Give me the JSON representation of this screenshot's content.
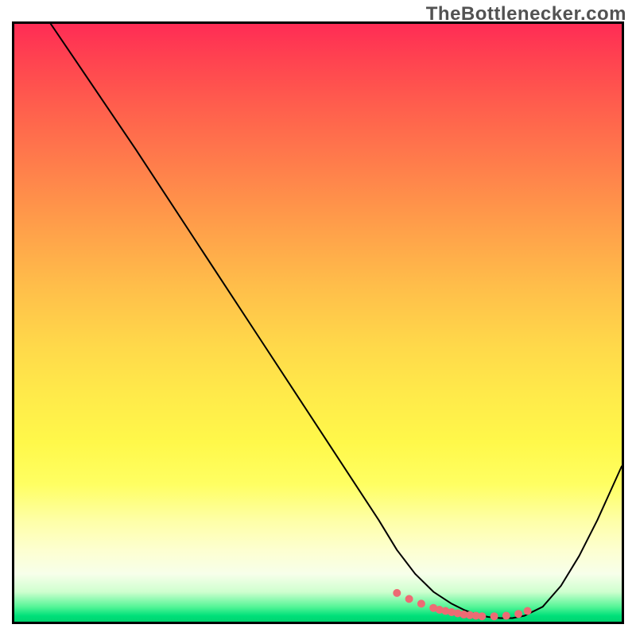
{
  "watermark": "TheBottlenecker.com",
  "chart_data": {
    "type": "line",
    "title": "",
    "xlabel": "",
    "ylabel": "",
    "xlim": [
      0,
      100
    ],
    "ylim": [
      0,
      100
    ],
    "series": [
      {
        "name": "bottleneck-curve",
        "x": [
          6,
          10,
          20,
          30,
          40,
          50,
          60,
          63,
          66,
          69,
          72,
          74,
          76,
          78,
          80,
          82,
          84,
          87,
          90,
          93,
          96,
          100
        ],
        "values": [
          100,
          94,
          79,
          63.5,
          48,
          32.5,
          17,
          12,
          8,
          5,
          3,
          2,
          1.2,
          0.8,
          0.6,
          0.6,
          1.0,
          2.5,
          6,
          11,
          17,
          26
        ]
      }
    ],
    "markers": {
      "name": "bottom-dots",
      "x": [
        63,
        65,
        67,
        69,
        70,
        71,
        72,
        73,
        74,
        75,
        76,
        77,
        79,
        81,
        83,
        84.5
      ],
      "values": [
        4.8,
        3.8,
        3.0,
        2.3,
        2.0,
        1.8,
        1.6,
        1.4,
        1.2,
        1.1,
        1.0,
        0.9,
        0.9,
        1.0,
        1.3,
        1.8
      ],
      "color": "#ed6b74",
      "radius_px": 5
    },
    "background": {
      "type": "vertical-heat-gradient",
      "top_color": "#ff2c55",
      "bottom_color": "#00d470"
    }
  }
}
